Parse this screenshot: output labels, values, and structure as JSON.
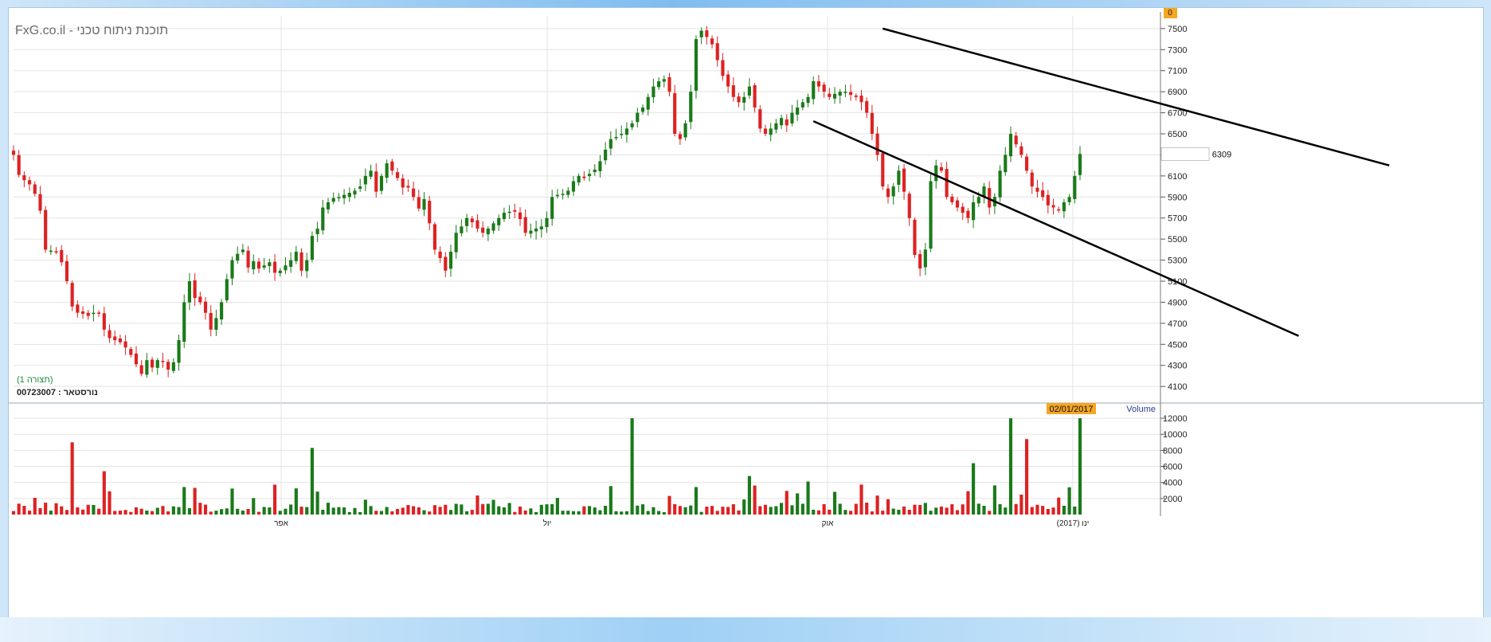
{
  "watermark": "FxG.co.il - תוכנת ניתוח טכני",
  "view_label": "(תצורה 1)",
  "instrument_label": "00723007 : נורסטאר",
  "top_right_badge": "0",
  "price_label": "6309",
  "date_badge": "02/01/2017",
  "volume_title": "Volume",
  "colors": {
    "up": "#1a7a1a",
    "down": "#dd2222",
    "grid": "#e3e3e3",
    "trendline": "#000000",
    "badge": "#f5a623",
    "frame": "#7fbdf0"
  },
  "chart_data": [
    {
      "type": "candlestick",
      "title": "",
      "y_ticks": [
        4100,
        4300,
        4500,
        4700,
        4900,
        5100,
        5300,
        5500,
        5700,
        5900,
        6100,
        6300,
        6500,
        6700,
        6900,
        7100,
        7300,
        7500
      ],
      "ylim": [
        3950,
        7620
      ],
      "x_ticks": [
        "אפר",
        "יול",
        "אוק",
        "ינו (2017)"
      ],
      "grid": true,
      "last_price": 6309,
      "series_close_approx": [
        6300,
        6110,
        6060,
        6020,
        5930,
        5770,
        5400,
        5390,
        5380,
        5280,
        5100,
        4860,
        4800,
        4790,
        4770,
        4800,
        4800,
        4640,
        4560,
        4540,
        4520,
        4470,
        4400,
        4310,
        4220,
        4350,
        4280,
        4350,
        4340,
        4260,
        4330,
        4540,
        4900,
        5100,
        4940,
        4900,
        4800,
        4640,
        4750,
        4900,
        5120,
        5300,
        5360,
        5400,
        5230,
        5290,
        5220,
        5250,
        5280,
        5180,
        5200,
        5250,
        5300,
        5380,
        5200,
        5300,
        5530,
        5600,
        5800,
        5850,
        5890,
        5900,
        5920,
        5940,
        5960,
        6000,
        6100,
        6150,
        5950,
        6100,
        6220,
        6150,
        6080,
        5990,
        5990,
        5900,
        5790,
        5880,
        5650,
        5400,
        5320,
        5200,
        5380,
        5560,
        5620,
        5700,
        5660,
        5600,
        5560,
        5600,
        5650,
        5700,
        5750,
        5760,
        5760,
        5690,
        5560,
        5580,
        5600,
        5620,
        5700,
        5900,
        5920,
        5930,
        5960,
        6050,
        6100,
        6080,
        6120,
        6160,
        6240,
        6350,
        6450,
        6470,
        6500,
        6550,
        6600,
        6700,
        6750,
        6850,
        6950,
        7000,
        7020,
        6900,
        6500,
        6450,
        6600,
        6900,
        7400,
        7480,
        7420,
        7350,
        7200,
        7050,
        6950,
        6850,
        6800,
        6850,
        6950,
        6750,
        6550,
        6500,
        6550,
        6600,
        6650,
        6580,
        6700,
        6750,
        6800,
        6850,
        7000,
        6950,
        6900,
        6850,
        6880,
        6900,
        6900,
        6870,
        6850,
        6800,
        6700,
        6500,
        6300,
        6000,
        5900,
        6000,
        6150,
        5950,
        5700,
        5350,
        5220,
        5400,
        6050,
        6200,
        6150,
        5900,
        5850,
        5800,
        5750,
        5700,
        5850,
        5900,
        6000,
        5800,
        5900,
        6150,
        6300,
        6500,
        6400,
        6300,
        6150,
        6000,
        5950,
        5900,
        5820,
        5800,
        5780,
        5850,
        5900,
        6100,
        6309
      ],
      "volume": {
        "ylim": [
          0,
          13000
        ],
        "y_ticks": [
          2000,
          4000,
          6000,
          8000,
          10000,
          12000
        ],
        "max_bar": 12000,
        "last_bar_date": "02/01/2017"
      },
      "trendlines": [
        {
          "name": "upper",
          "from": {
            "date_index": 163,
            "price": 7500
          },
          "to": {
            "date_index": 258,
            "price": 6200
          }
        },
        {
          "name": "lower",
          "from": {
            "date_index": 150,
            "price": 6620
          },
          "to": {
            "date_index": 241,
            "price": 4580
          }
        }
      ]
    }
  ]
}
